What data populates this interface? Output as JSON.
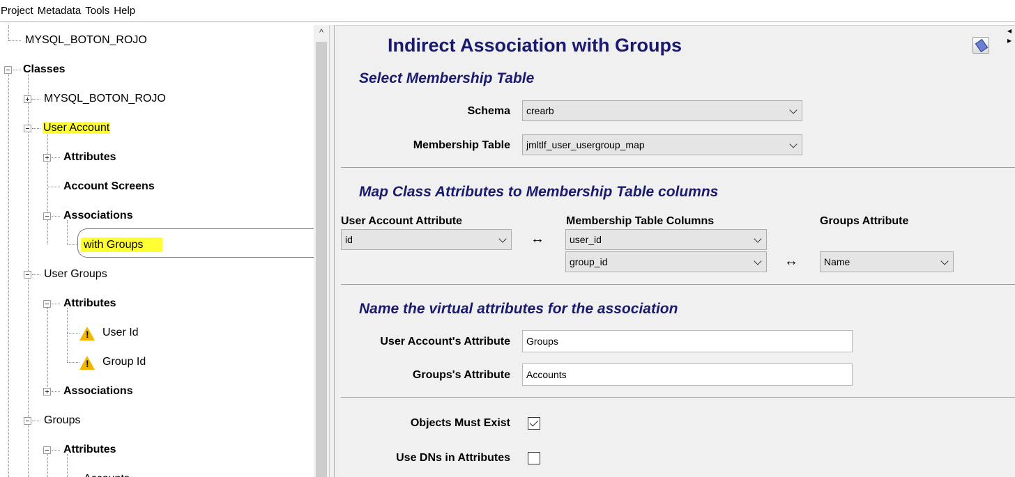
{
  "menu": [
    "Project",
    "Metadata",
    "Tools",
    "Help"
  ],
  "tree": {
    "nodes": [
      {
        "label": "MYSQL_BOTON_ROJO"
      },
      {
        "label": "Classes"
      },
      {
        "label": "MYSQL_BOTON_ROJO"
      },
      {
        "label": "User Account"
      },
      {
        "label": "Attributes"
      },
      {
        "label": "Account Screens"
      },
      {
        "label": "Associations"
      },
      {
        "label": "with Groups"
      },
      {
        "label": "User Groups"
      },
      {
        "label": "Attributes"
      },
      {
        "label": "User Id"
      },
      {
        "label": "Group Id"
      },
      {
        "label": "Associations"
      },
      {
        "label": "Groups"
      },
      {
        "label": "Attributes"
      },
      {
        "label": "Accounts"
      }
    ]
  },
  "panel": {
    "title": "Indirect Association with Groups",
    "section1": {
      "title": "Select Membership Table",
      "schema_label": "Schema",
      "schema_value": "crearb",
      "table_label": "Membership Table",
      "table_value": "jmltlf_user_usergroup_map"
    },
    "section2": {
      "title": "Map Class Attributes to Membership Table columns",
      "col1": "User Account Attribute",
      "col2": "Membership Table Columns",
      "col3": "Groups Attribute",
      "ua_attr": "id",
      "mt_col1": "user_id",
      "mt_col2": "group_id",
      "groups_attr": "Name",
      "arrow": "↔"
    },
    "section3": {
      "title": "Name the virtual attributes for the association",
      "ua_label": "User Account's Attribute",
      "ua_value": "Groups",
      "groups_label": "Groups's Attribute",
      "groups_value": "Accounts"
    },
    "options": {
      "must_exist_label": "Objects Must Exist",
      "must_exist_checked": true,
      "use_dns_label": "Use DNs in Attributes",
      "use_dns_checked": false
    }
  },
  "colors": {
    "title_navy": "#1a1a6e",
    "highlight": "#ffff33",
    "warning": "#f2b600"
  }
}
